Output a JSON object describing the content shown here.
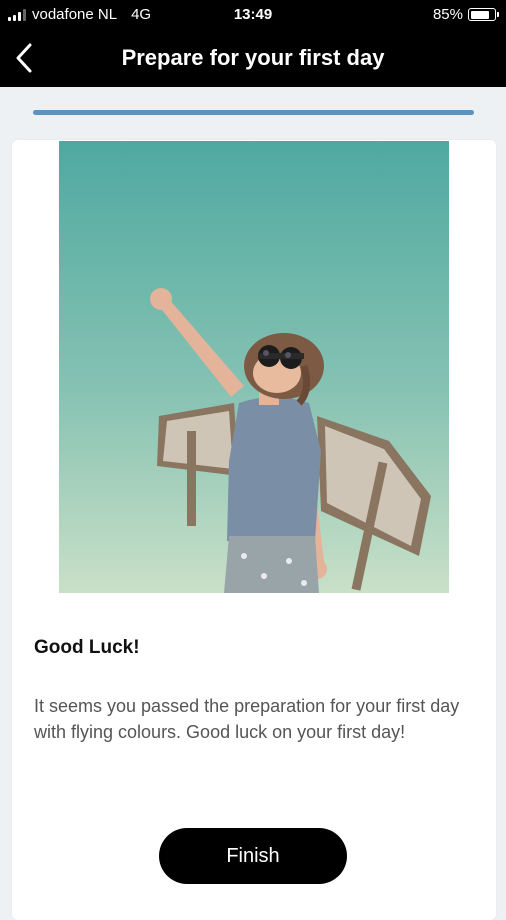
{
  "status_bar": {
    "carrier": "vodafone NL",
    "network": "4G",
    "time": "13:49",
    "battery_percent": "85%",
    "battery_level": 0.85
  },
  "header": {
    "title": "Prepare for your first day",
    "back_icon": "chevron-left-icon"
  },
  "progress": {
    "value": 1.0,
    "color": "#5b94bf"
  },
  "card": {
    "image_icon": "photo-child-aviator",
    "heading": "Good Luck!",
    "body": "It seems you passed the preparation for your first day with flying colours. Good luck on your first day!",
    "button_label": "Finish"
  }
}
